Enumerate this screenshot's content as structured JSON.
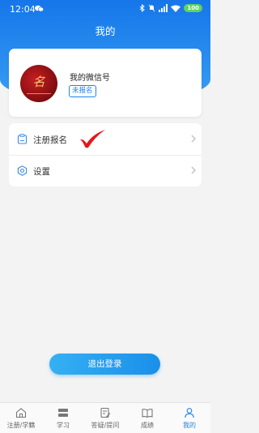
{
  "status_bar": {
    "time": "12:04",
    "battery": "100"
  },
  "header": {
    "title": "我的"
  },
  "profile": {
    "name": "我的微信号",
    "status_badge": "未报名"
  },
  "menu": {
    "items": [
      {
        "label": "注册报名",
        "icon": "clipboard-icon"
      },
      {
        "label": "设置",
        "icon": "settings-icon"
      }
    ]
  },
  "logout_label": "退出登录",
  "tabs": [
    {
      "label": "注册/学籍",
      "icon": "home-icon"
    },
    {
      "label": "学习",
      "icon": "study-icon"
    },
    {
      "label": "答疑/提问",
      "icon": "edit-icon"
    },
    {
      "label": "成绩",
      "icon": "book-icon"
    },
    {
      "label": "我的",
      "icon": "user-icon",
      "active": true
    }
  ],
  "colors": {
    "accent": "#1d84ec",
    "header_top": "#1676ea",
    "checkmark": "#e8141a"
  }
}
